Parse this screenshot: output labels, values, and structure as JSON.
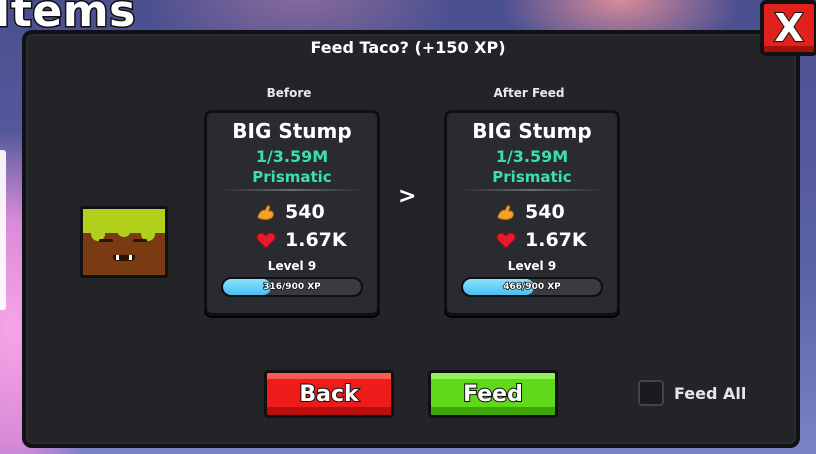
{
  "window": {
    "title": "Items"
  },
  "dialog": {
    "title": "Feed Taco? (+150 XP)",
    "close_label": "X"
  },
  "before": {
    "label": "Before",
    "name": "BIG Stump",
    "count": "1/3.59M",
    "rarity": "Prismatic",
    "power": "540",
    "health": "1.67K",
    "level": "Level 9",
    "xp_text": "316/900 XP",
    "xp_fraction": 0.351
  },
  "after": {
    "label": "After Feed",
    "name": "BIG Stump",
    "count": "1/3.59M",
    "rarity": "Prismatic",
    "power": "540",
    "health": "1.67K",
    "level": "Level 9",
    "xp_text": "466/900 XP",
    "xp_fraction": 0.518
  },
  "arrow": ">",
  "buttons": {
    "back": "Back",
    "feed": "Feed"
  },
  "feed_all": {
    "label": "Feed All",
    "checked": false
  },
  "icons": {
    "power": "flexed-arm-icon",
    "health": "heart-icon",
    "pet": "taco-pet-icon",
    "close": "close-icon"
  },
  "colors": {
    "rarity": "#38e0b0",
    "back_button": "#ee1b1b",
    "feed_button": "#61d91b",
    "xp_bar": "#48bff1"
  }
}
